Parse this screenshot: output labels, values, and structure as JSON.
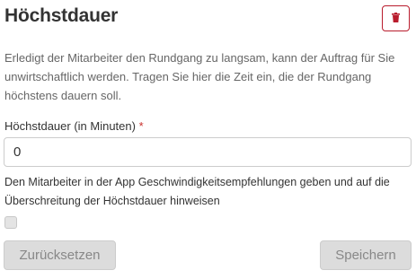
{
  "header": {
    "title": "Höchstdauer",
    "delete_icon": "trash-icon",
    "accent_color": "#b91c2d"
  },
  "description": "Erledigt der Mitarbeiter den Rundgang zu langsam, kann der Auftrag für Sie unwirtschaftlich werden. Tragen Sie hier die Zeit ein, die der Rundgang höchstens dauern soll.",
  "field": {
    "label": "Höchstdauer (in Minuten)",
    "required_mark": "*",
    "value": "0"
  },
  "checkbox": {
    "label": "Den Mitarbeiter in der App Geschwindigkeitsempfehlungen geben und auf die Überschreitung der Höchstdauer hinweisen",
    "checked": false
  },
  "buttons": {
    "reset_label": "Zurücksetzen",
    "save_label": "Speichern"
  }
}
